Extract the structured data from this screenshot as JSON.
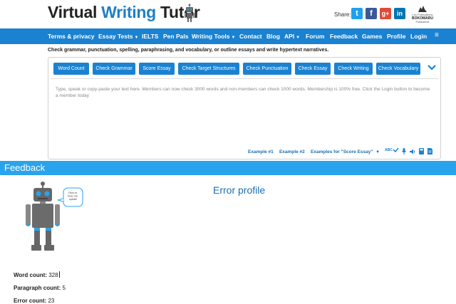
{
  "header": {
    "logo": {
      "part1": "Virtual",
      "part2": "Writing",
      "part3": "Tutor"
    },
    "share_label": "Share:",
    "social": {
      "twitter": "t",
      "facebook": "f",
      "googleplus": "g+",
      "linkedin": "in"
    },
    "publisher": {
      "line1": "Les Publications",
      "line2": "BOKOMARU",
      "line3": "Publications"
    }
  },
  "nav": {
    "items": [
      {
        "label": "Terms & privacy"
      },
      {
        "label": "Essay Tests"
      },
      {
        "label": "IELTS"
      },
      {
        "label": "Pen Pals"
      },
      {
        "label": "Writing Tools"
      },
      {
        "label": "Contact"
      },
      {
        "label": "Blog"
      },
      {
        "label": "API"
      },
      {
        "label": "Forum"
      },
      {
        "label": "Feedback"
      },
      {
        "label": "Games"
      },
      {
        "label": "Profile"
      },
      {
        "label": "Login"
      },
      {
        "label": "≡"
      }
    ]
  },
  "subtitle": "Check grammar, punctuation, spelling, paraphrasing, and vocabulary, or outline essays and write hypertext narratives.",
  "tools": {
    "buttons": [
      {
        "label": "Word Count"
      },
      {
        "label": "Check Grammar"
      },
      {
        "label": "Score Essay"
      },
      {
        "label": "Check Target Structures"
      },
      {
        "label": "Check Punctuation"
      },
      {
        "label": "Check Essay"
      },
      {
        "label": "Check Writing"
      },
      {
        "label": "Check Vocabulary"
      }
    ],
    "placeholder": "Type, speak or copy-paste your text here. Members can now check 3000 words and non-members can check 1000 words. Membership is 100% free. Click the Login button to become a member today",
    "examples": [
      {
        "label": "Example #1"
      },
      {
        "label": "Example #2"
      },
      {
        "label": "Examples for \"Score Essay\""
      }
    ],
    "icons": [
      "spellcheck-icon",
      "microphone-icon",
      "speaker-icon",
      "save-icon",
      "document-icon"
    ],
    "abc_label": "ABC"
  },
  "feedback": {
    "title": "Feedback",
    "bubble": "Click to hear me speak!",
    "heading": "Error profile",
    "stats": [
      {
        "label": "Word count:",
        "value": "328"
      },
      {
        "label": "Paragraph count:",
        "value": "5"
      },
      {
        "label": "Error count:",
        "value": "23"
      }
    ]
  },
  "colors": {
    "brand": "#1a82d1",
    "feedback_bar": "#29a3eb",
    "link": "#1a6fb5"
  }
}
